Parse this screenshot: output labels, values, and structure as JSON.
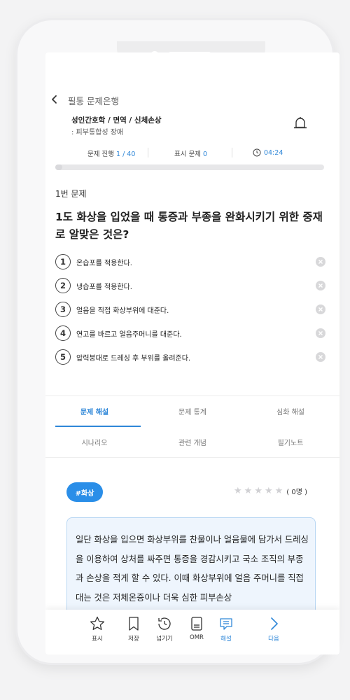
{
  "header": {
    "title": "필통 문제은행"
  },
  "course": {
    "path": "성인간호학 / 면역 / 신체손상",
    "subtopic": ": 피부통합성 장애"
  },
  "stats": {
    "progress_label": "문제 진행",
    "progress_value": "1 / 40",
    "marked_label": "표시 문제",
    "marked_value": "0",
    "timer": "04:24",
    "progress_fraction": 0.025
  },
  "question": {
    "number": "1번 문제",
    "text": "1도 화상을 입었을 때 통증과 부종을 완화시키기 위한 중재로 알맞은 것은?"
  },
  "options": [
    {
      "num": "1",
      "text": "온습포를 적용한다."
    },
    {
      "num": "2",
      "text": "냉습포를 적용한다."
    },
    {
      "num": "3",
      "text": "얼음을 직접 화상부위에 대준다."
    },
    {
      "num": "4",
      "text": "연고를 바르고 얼음주머니를 대준다."
    },
    {
      "num": "5",
      "text": "압력붕대로 드레싱 후 부위를 올려준다."
    }
  ],
  "tabs": {
    "row1": [
      "문제 해설",
      "문제 통계",
      "심화 해설"
    ],
    "row2": [
      "시나리오",
      "관련 개념",
      "필기노트"
    ]
  },
  "explanation": {
    "tag": "#화상",
    "rating_count": "( 0명 )",
    "stars": 0,
    "text": "일단 화상을 입으면 화상부위를 찬물이나 얼음물에 담가서 드레싱을 이용하여 상처를 싸주면 통증을 경감시키고 국소 조직의 부종과 손상을 적게 할 수 있다. 이때 화상부위에 얼음 주머니를 직접 대는 것은 저체온증이나 더욱 심한 피부손상"
  },
  "bottom_bar": {
    "mark": "표시",
    "save": "저장",
    "skip": "넘기기",
    "omr": "OMR",
    "explain": "해설",
    "next": "다음"
  },
  "colors": {
    "accent": "#2f87d8",
    "tag_bg": "#2a8ee8",
    "box_bg": "#eef5fd"
  }
}
